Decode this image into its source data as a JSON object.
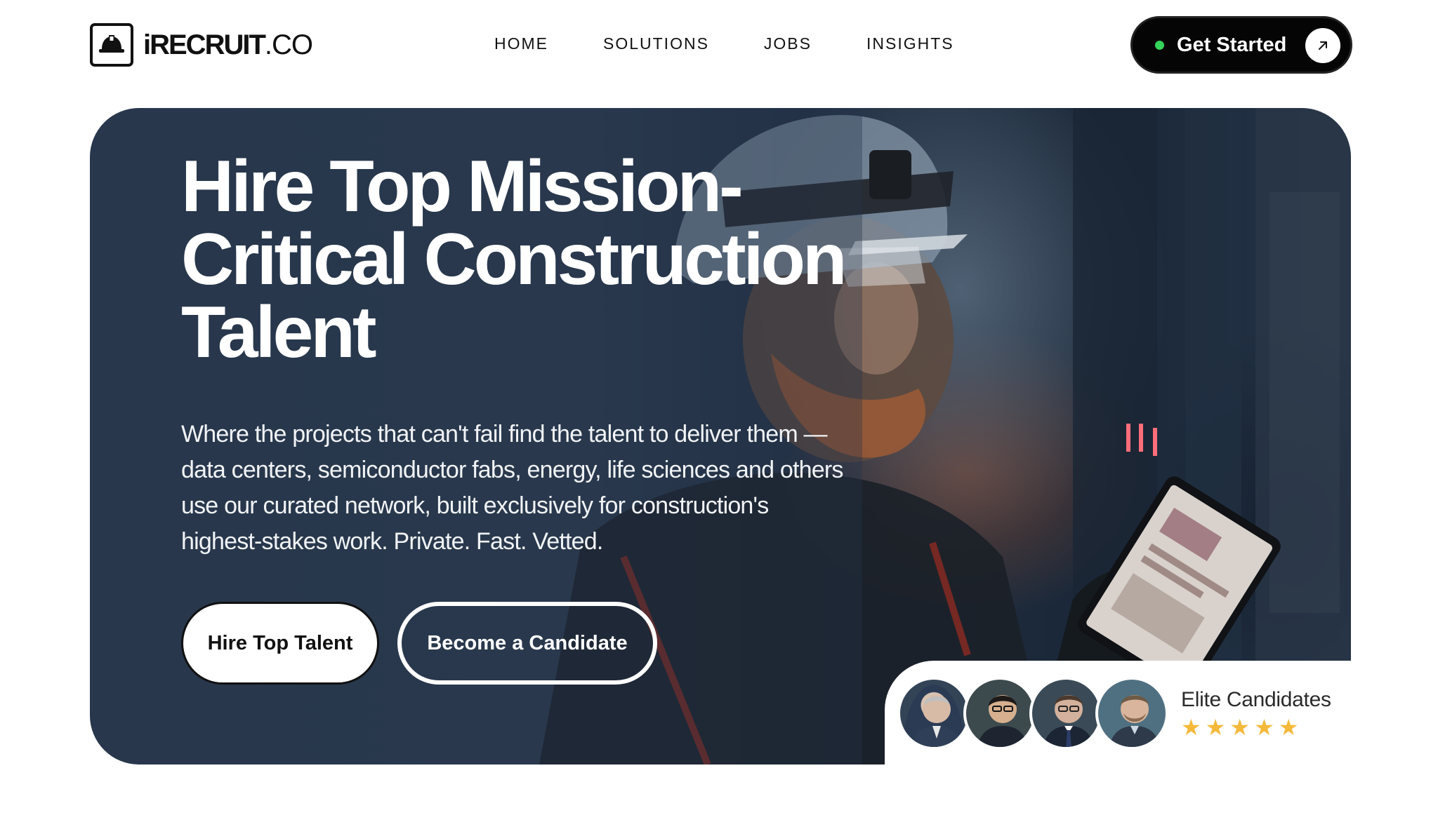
{
  "brand": {
    "name_main": "iRECRUIT",
    "name_suffix": ".CO",
    "logo_icon": "hardhat-icon"
  },
  "nav": {
    "items": [
      {
        "label": "HOME"
      },
      {
        "label": "SOLUTIONS"
      },
      {
        "label": "JOBS"
      },
      {
        "label": "INSIGHTS"
      }
    ],
    "cta": {
      "label": "Get Started",
      "status_color": "#35d35a",
      "icon": "arrow-up-right-icon"
    }
  },
  "hero": {
    "title": "Hire Top Mission-Critical Construction Talent",
    "description": "Where the projects that can't fail find the talent to deliver them — data centers, semiconductor fabs, energy, life sciences and others use our curated network, built exclusively for construction's highest-stakes work. Private. Fast. Vetted.",
    "primary_button": "Hire Top Talent",
    "secondary_button": "Become a Candidate"
  },
  "social_proof": {
    "label": "Elite Candidates",
    "rating": 5,
    "max_rating": 5,
    "star_color": "#f4b93a",
    "avatar_count": 4
  }
}
